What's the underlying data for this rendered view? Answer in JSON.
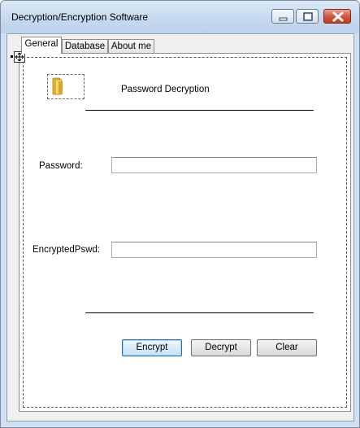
{
  "window": {
    "title": "Decryption/Encryption Software",
    "controls": {
      "minimize": "minimize-icon",
      "maximize": "maximize-icon",
      "close": "close-icon"
    }
  },
  "tabs": [
    {
      "label": "General",
      "active": true
    },
    {
      "label": "Database",
      "active": false
    },
    {
      "label": "About me",
      "active": false
    }
  ],
  "general": {
    "heading": "Password Decryption",
    "image_icon": "folder-icon",
    "password": {
      "label": "Password:",
      "value": ""
    },
    "encrypted": {
      "label": "EncryptedPswd:",
      "value": ""
    },
    "buttons": {
      "encrypt": "Encrypt",
      "decrypt": "Decrypt",
      "clear": "Clear"
    }
  }
}
